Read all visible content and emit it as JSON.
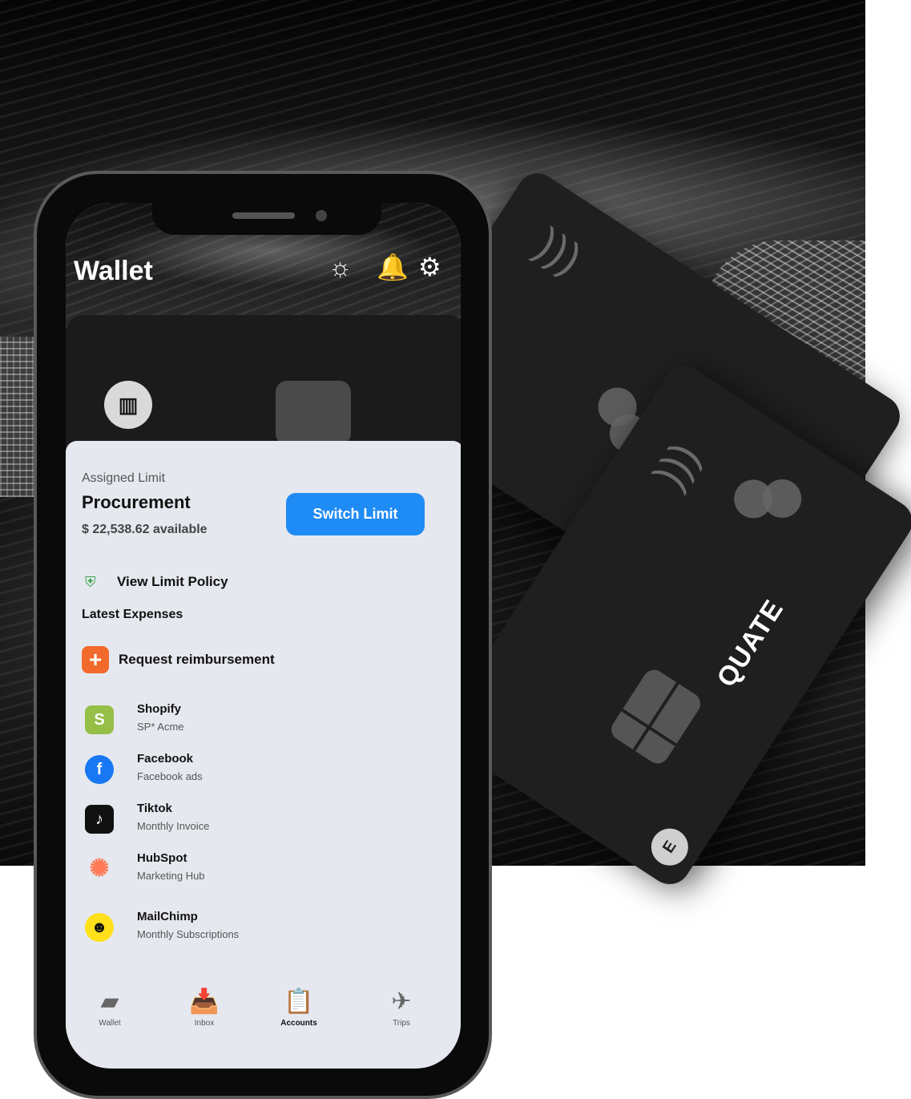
{
  "app": {
    "title": "Wallet"
  },
  "top_icons": {
    "sparkle": "sparkle-icon",
    "bell": "bell-icon",
    "settings": "gear-icon"
  },
  "cards": {
    "brand": "QUATE"
  },
  "limit": {
    "label": "Assigned Limit",
    "name": "Procurement",
    "available": "$ 22,538.62 available",
    "switch_button": "Switch Limit"
  },
  "policy": {
    "label": "View Limit Policy"
  },
  "expenses_title": "Latest Expenses",
  "reimbursement": {
    "label": "Request reimbursement"
  },
  "expenses": [
    {
      "name": "Shopify",
      "sub": "SP* Acme"
    },
    {
      "name": "Facebook",
      "sub": "Facebook ads"
    },
    {
      "name": "Tiktok",
      "sub": "Monthly Invoice"
    },
    {
      "name": "HubSpot",
      "sub": "Marketing Hub"
    },
    {
      "name": "MailChimp",
      "sub": "Monthly Subscriptions"
    }
  ],
  "nav": [
    {
      "label": "Wallet"
    },
    {
      "label": "Inbox"
    },
    {
      "label": "Accounts"
    },
    {
      "label": "Trips"
    }
  ],
  "colors": {
    "primary_button": "#1f8bf5",
    "reimbursement": "#f26a2b",
    "shopify": "#95bf47",
    "facebook": "#1877f2",
    "hubspot": "#ff7a59",
    "mailchimp": "#ffe01b"
  }
}
